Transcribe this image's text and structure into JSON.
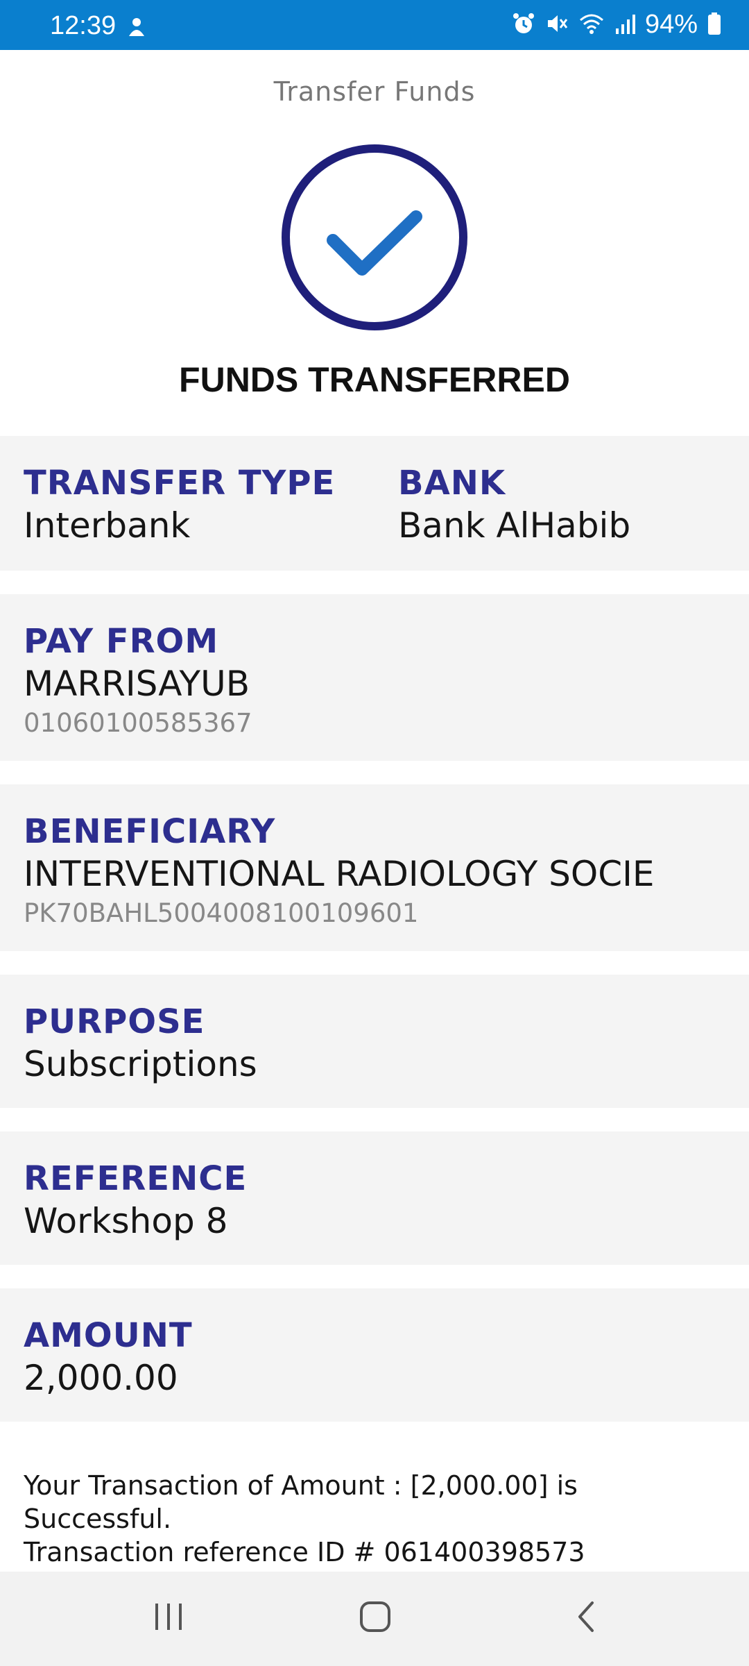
{
  "status": {
    "time": "12:39",
    "battery": "94%",
    "icons": [
      "person-icon",
      "alarm-icon",
      "mute-icon",
      "wifi-icon",
      "signal-icon",
      "battery-icon"
    ]
  },
  "screen": {
    "title": "Transfer Funds",
    "heading": "FUNDS TRANSFERRED",
    "success_icon": "check-circle-icon"
  },
  "details": {
    "transfer_type": {
      "label": "TRANSFER TYPE",
      "value": "Interbank"
    },
    "bank": {
      "label": "BANK",
      "value": "Bank AlHabib"
    },
    "pay_from": {
      "label": "PAY FROM",
      "value": "MARRISAYUB",
      "account": "01060100585367"
    },
    "beneficiary": {
      "label": "BENEFICIARY",
      "value": "INTERVENTIONAL RADIOLOGY SOCIE",
      "account": "PK70BAHL5004008100109601"
    },
    "purpose": {
      "label": "PURPOSE",
      "value": "Subscriptions"
    },
    "reference": {
      "label": "REFERENCE",
      "value": "Workshop 8"
    },
    "amount": {
      "label": "AMOUNT",
      "value": "2,000.00"
    }
  },
  "message": {
    "line1": "Your Transaction of Amount : [2,000.00] is Successful.",
    "line2": "Transaction reference ID # 061400398573"
  },
  "navbar": {
    "icons": [
      "recent-apps-icon",
      "home-icon",
      "back-icon"
    ]
  },
  "colors": {
    "status_bar": "#0a7fce",
    "label": "#2d2e8f",
    "card_bg": "#f4f4f4",
    "check_ring": "#1f1f7a",
    "check_mark": "#1f6fc4"
  }
}
